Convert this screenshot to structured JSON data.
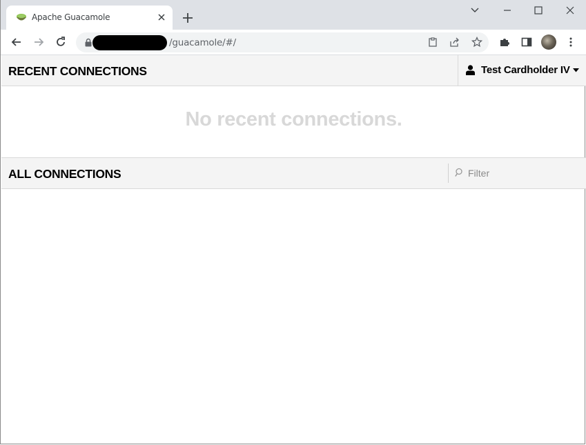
{
  "browser": {
    "tab": {
      "title": "Apache Guacamole"
    },
    "address": {
      "url": "/guacamole/#/"
    }
  },
  "page": {
    "recent": {
      "title": "RECENT CONNECTIONS",
      "empty_message": "No recent connections."
    },
    "user_menu": {
      "username": "Test Cardholder IV"
    },
    "all": {
      "title": "ALL CONNECTIONS",
      "filter_placeholder": "Filter"
    }
  },
  "colors": {
    "header_bg": "#f4f4f4",
    "empty_text": "#d8d8d8",
    "favicon": "#6aa84f"
  }
}
